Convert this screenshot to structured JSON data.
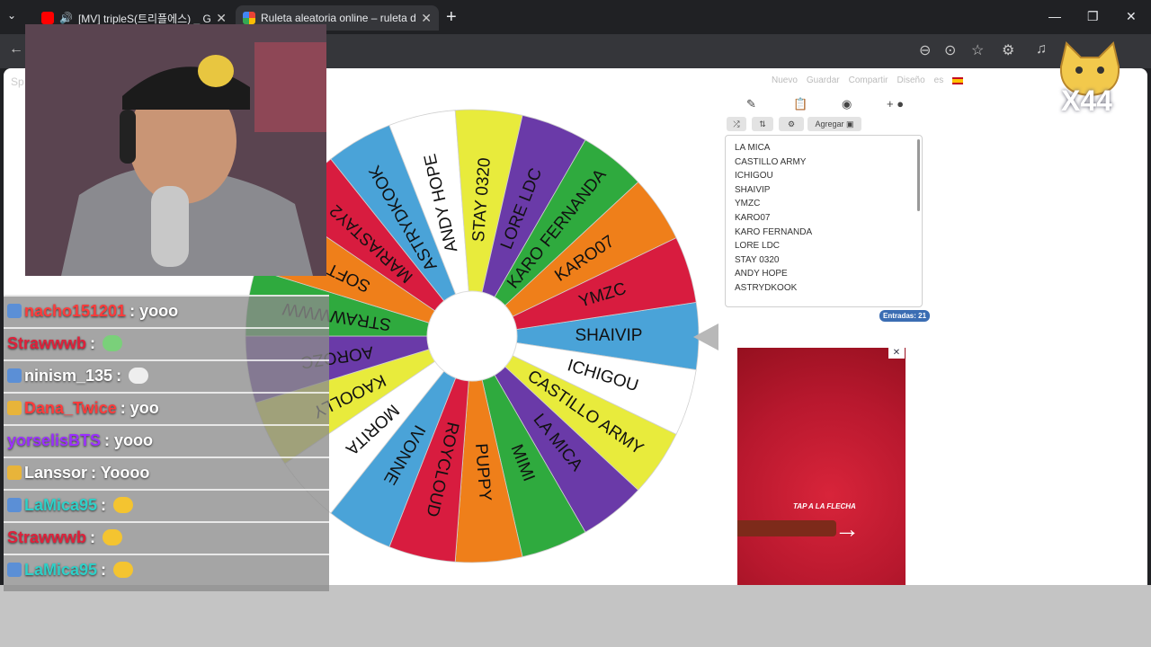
{
  "browser": {
    "tabs": [
      {
        "title": "[MV] tripleS(트리플에스) _ Ge",
        "favicon_color": "#ff0000"
      },
      {
        "title": "Ruleta aleatoria online – ruleta de",
        "favicon_color": "#34a853"
      }
    ],
    "window_controls": [
      "—",
      "❐",
      "✕"
    ]
  },
  "site": {
    "menu": [
      "Nuevo",
      "Guardar",
      "Compartir",
      "Diseño",
      "es"
    ],
    "editor_tabs": [
      "edit-icon",
      "clipboard-icon",
      "hide-icon",
      "add-color-icon"
    ],
    "buttons": {
      "add_label": "Agregar"
    },
    "entries": [
      "LA MICA",
      "CASTILLO ARMY",
      "ICHIGOU",
      "SHAIVIP",
      "YMZC",
      "KARO07",
      "KARO FERNANDA",
      "LORE LDC",
      "STAY 0320",
      "ANDY HOPE",
      "ASTRYDKOOK"
    ],
    "entries_count_label": "Entradas: 21"
  },
  "wheel": {
    "segments": [
      {
        "label": "SHAIVIP",
        "color": "#4aa3d8"
      },
      {
        "label": "ICHIGOU",
        "color": "#ffffff"
      },
      {
        "label": "CASTILLO ARMY",
        "color": "#e8eb3c"
      },
      {
        "label": "LA MICA",
        "color": "#6a3aa8"
      },
      {
        "label": "MIMI",
        "color": "#2faa3e"
      },
      {
        "label": "PUPPY",
        "color": "#ef7f1a"
      },
      {
        "label": "ROYCLOUD",
        "color": "#d81c3f"
      },
      {
        "label": "IVONNE",
        "color": "#4aa3d8"
      },
      {
        "label": "MORITA",
        "color": "#ffffff"
      },
      {
        "label": "KAOOLLY",
        "color": "#e8eb3c"
      },
      {
        "label": "AOROZC",
        "color": "#6a3aa8"
      },
      {
        "label": "STRAWWWW",
        "color": "#2faa3e"
      },
      {
        "label": "SOFT",
        "color": "#ef7f1a"
      },
      {
        "label": "MARIASTAY2",
        "color": "#d81c3f"
      },
      {
        "label": "ASTRYDKOOK",
        "color": "#4aa3d8"
      },
      {
        "label": "ANDY HOPE",
        "color": "#ffffff"
      },
      {
        "label": "STAY 0320",
        "color": "#e8eb3c"
      },
      {
        "label": "LORE LDC",
        "color": "#6a3aa8"
      },
      {
        "label": "KARO FERNANDA",
        "color": "#2faa3e"
      },
      {
        "label": "KARO07",
        "color": "#ef7f1a"
      },
      {
        "label": "YMZC",
        "color": "#d81c3f"
      }
    ]
  },
  "ad": {
    "headline": "TAP A LA FLECHA"
  },
  "chat": {
    "messages": [
      {
        "user": "nacho151201",
        "text": ": yooo",
        "user_color": "#ff3b3b"
      },
      {
        "user": "Strawwwb",
        "text": ":",
        "user_color": "#e0203a"
      },
      {
        "user": "ninism_135",
        "text": ":",
        "user_color": "#ffffff"
      },
      {
        "user": "Dana_Twice",
        "text": ": yoo",
        "user_color": "#ff3b3b"
      },
      {
        "user": "yorselisBTS",
        "text": ": yooo",
        "user_color": "#9b30ff"
      },
      {
        "user": "Lanssor",
        "text": ": Yoooo",
        "user_color": "#ffffff"
      },
      {
        "user": "LaMica95",
        "text": ":",
        "user_color": "#2fd0c8"
      },
      {
        "user": "Strawwwb",
        "text": ":",
        "user_color": "#e0203a"
      },
      {
        "user": "LaMica95",
        "text": ":",
        "user_color": "#2fd0c8"
      }
    ]
  },
  "overlay": {
    "mascot_text": "X44"
  }
}
